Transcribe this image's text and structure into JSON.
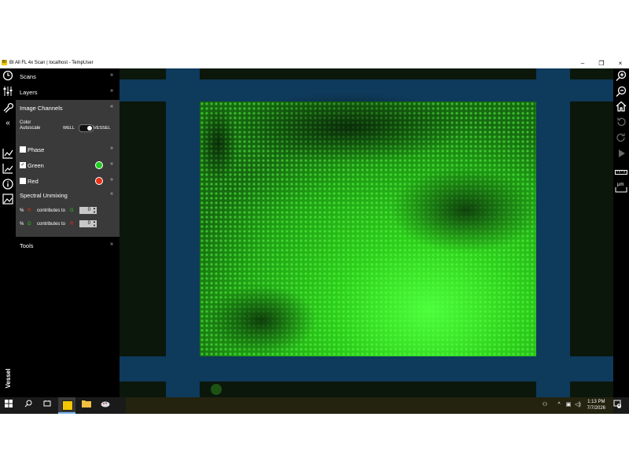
{
  "window": {
    "title": "BI All FL 4x Scan | localhost - TempUser",
    "app_icon": "BI",
    "minimize": "–",
    "maximize": "❐",
    "close": "×"
  },
  "sidebar": {
    "icons": [
      "clock-icon",
      "sliders-icon",
      "wrench-icon",
      "collapse-icon",
      "graph-icon",
      "chart-line-icon",
      "info-icon",
      "image-icon"
    ],
    "collapse_glyph": "«",
    "vessel_label": "Vessel"
  },
  "panel": {
    "scans": "Scans",
    "layers": "Layers",
    "image_channels": "Image Channels",
    "color_autoscale_1": "Color",
    "color_autoscale_2": "Autoscale",
    "toggle_left": "WELL",
    "toggle_right": "VESSEL",
    "phase": "Phase",
    "green": "Green",
    "red": "Red",
    "spectral_unmixing": "Spectral Unmixing",
    "unmix_pct": "%",
    "unmix_r": "R",
    "unmix_g": "G",
    "contributes_to": "contributes to",
    "unmix_value_1": "0",
    "unmix_value_2": "0",
    "tools": "Tools",
    "green_color": "#22cc22",
    "red_color": "#e83018"
  },
  "viewer": {
    "frame_color": "#0e3a5c",
    "image_color": "#2ecc1a"
  },
  "rightbar": {
    "icons": [
      "zoom-in-icon",
      "zoom-out-icon",
      "home-icon",
      "rotate-forward-icon",
      "rotate-back-icon",
      "play-icon",
      "ruler-icon",
      "micron-icon"
    ],
    "micron_label": "µm"
  },
  "taskbar": {
    "time": "1:13 PM",
    "date": "7/7/2026",
    "notifications": "4"
  }
}
